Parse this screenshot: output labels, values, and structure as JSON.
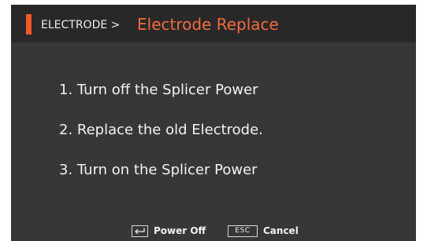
{
  "header": {
    "breadcrumb": "ELECTRODE >",
    "title": "Electrode Replace"
  },
  "steps": [
    "1. Turn off the Splicer Power",
    "2. Replace the old Electrode.",
    "3. Turn on the Splicer Power"
  ],
  "footer": {
    "enter_icon": "enter-key-icon",
    "enter_label": "Power Off",
    "esc_keycap": "ESC",
    "esc_label": "Cancel"
  },
  "colors": {
    "screen_background": "#373737",
    "header_background": "#282828",
    "accent": "#f05a28",
    "title": "#f26a3c",
    "text": "#f2f2f2"
  }
}
